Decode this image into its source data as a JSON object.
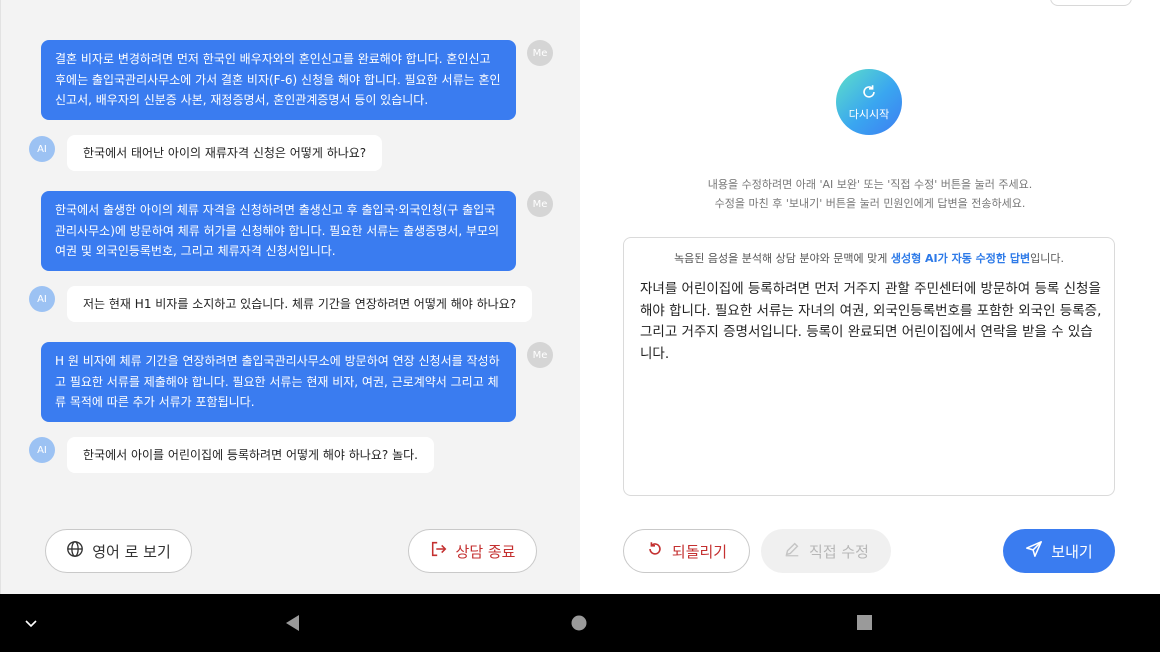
{
  "chat": {
    "messages": [
      {
        "role": "me",
        "avatar": "Me",
        "text": "결혼 비자로 변경하려면 먼저 한국인 배우자와의 혼인신고를 완료해야 합니다. 혼인신고 후에는 출입국관리사무소에 가서 결혼 비자(F-6) 신청을 해야 합니다. 필요한 서류는 혼인신고서, 배우자의 신분증 사본, 재정증명서, 혼인관계증명서 등이 있습니다."
      },
      {
        "role": "ai",
        "avatar": "AI",
        "text": "한국에서 태어난 아이의 재류자격 신청은 어떻게 하나요?"
      },
      {
        "role": "me",
        "avatar": "Me",
        "text": "한국에서 출생한 아이의 체류 자격을 신청하려면 출생신고 후 출입국·외국인청(구 출입국관리사무소)에 방문하여 체류 허가를 신청해야 합니다. 필요한 서류는 출생증명서, 부모의 여권 및 외국인등록번호, 그리고 체류자격 신청서입니다."
      },
      {
        "role": "ai",
        "avatar": "AI",
        "text": "저는 현재 H1 비자를 소지하고 있습니다. 체류 기간을 연장하려면 어떻게 해야 하나요?"
      },
      {
        "role": "me",
        "avatar": "Me",
        "text": "H 원 비자에 체류 기간을 연장하려면 출입국관리사무소에 방문하여 연장 신청서를 작성하고 필요한 서류를 제출해야 합니다. 필요한 서류는 현재 비자, 여권, 근로계약서 그리고 체류 목적에 따른 추가 서류가 포함됩니다."
      },
      {
        "role": "ai",
        "avatar": "AI",
        "text": "한국에서 아이를 어린이집에 등록하려면 어떻게 해야 하나요? 놀다."
      }
    ],
    "buttons": {
      "translate": "영어 로 보기",
      "end": "상담 종료"
    }
  },
  "editor": {
    "restart_label": "다시시작",
    "notice_line1": "내용을 수정하려면 아래 'AI 보완' 또는 '직접 수정' 버튼을 눌러 주세요.",
    "notice_line2": "수정을 마친 후 '보내기' 버튼을 눌러 민원인에게 답변을 전송하세요.",
    "panel_head_pre": "녹음된 음성을 분석해 상담 분야와 문맥에 맞게 ",
    "panel_head_highlight": "생성형 AI가 자동 수정한 답변",
    "panel_head_post": "입니다.",
    "answer": "자녀를 어린이집에 등록하려면 먼저 거주지 관할 주민센터에 방문하여 등록 신청을 해야 합니다. 필요한 서류는 자녀의 여권, 외국인등록번호를 포함한 외국인 등록증, 그리고 거주지 증명서입니다. 등록이 완료되면 어린이집에서 연락을 받을 수 있습니다.",
    "buttons": {
      "undo": "되돌리기",
      "edit": "직접 수정",
      "send": "보내기"
    }
  },
  "icons": {
    "translate": "globe-icon",
    "end": "exit-icon",
    "restart": "refresh-icon",
    "undo": "undo-icon",
    "edit": "pencil-icon",
    "send": "send-icon"
  },
  "colors": {
    "accent": "#3a7cf0",
    "danger": "#c43030",
    "chat_bg": "#f3f3f3"
  }
}
